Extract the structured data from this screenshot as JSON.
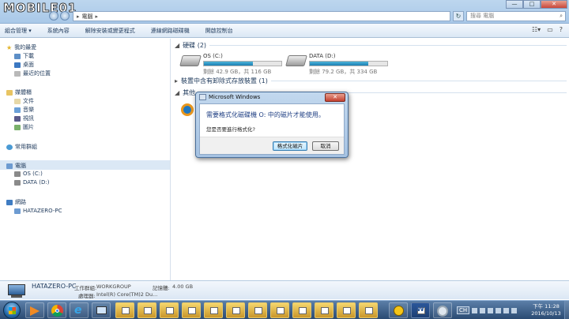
{
  "watermark": {
    "text": "MOBILE01"
  },
  "address": {
    "path": "電腦",
    "search_placeholder": "搜尋 電腦"
  },
  "window_controls": {
    "minimize": "—",
    "maximize": "□",
    "close": "✕"
  },
  "toolbar": {
    "items": [
      "組合管理 ▾",
      "系統內容",
      "解除安裝或變更程式",
      "連線網路磁碟機",
      "開啟控制台"
    ]
  },
  "sidebar": {
    "favorites": {
      "label": "我的最愛",
      "items": [
        "下載",
        "桌面",
        "最近的位置"
      ]
    },
    "libraries": {
      "label": "媒體櫃",
      "items": [
        "文件",
        "音樂",
        "視訊",
        "圖片"
      ]
    },
    "homegroup": {
      "label": "常用群組"
    },
    "computer": {
      "label": "電腦",
      "items": [
        "OS (C:)",
        "DATA (D:)"
      ]
    },
    "network": {
      "label": "網路",
      "items": [
        "HATAZERO-PC"
      ]
    }
  },
  "content": {
    "hdd_group": "硬碟 (2)",
    "removable_group": "裝置中含有卸除式存放裝置 (1)",
    "other_group": "其他",
    "drives": [
      {
        "name": "OS (C:)",
        "size": "剩餘 42.9 GB，共 116 GB",
        "used_fraction": 0.63
      },
      {
        "name": "DATA (D:)",
        "size": "剩餘 79.2 GB，共 334 GB",
        "used_fraction": 0.76
      }
    ]
  },
  "dialog": {
    "title": "Microsoft Windows",
    "message": "需要格式化磁碟機 O: 中的磁片才能使用。",
    "question": "您是否要進行格式化?",
    "ok_label": "格式化磁片",
    "cancel_label": "取消",
    "close": "✕"
  },
  "details": {
    "pc_name": "HATAZERO-PC",
    "workgroup_label": "工作群組:",
    "workgroup": "WORKGROUP",
    "memory_label": "記憶體:",
    "memory": "4.00 GB",
    "cpu_label": "處理器:",
    "cpu": "Intel(R) Core(TM)2 Du..."
  },
  "taskbar": {
    "ime": "CH",
    "time": "下午 11:28",
    "date": "2016/10/13"
  }
}
